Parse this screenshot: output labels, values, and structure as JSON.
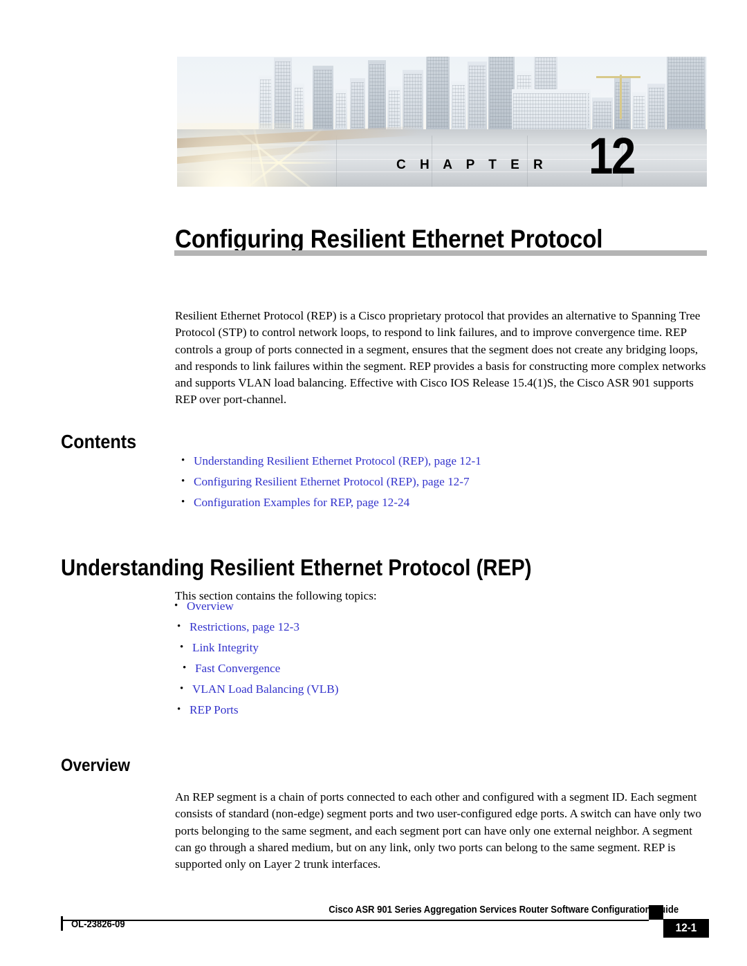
{
  "banner": {
    "chapter_word": "C H A P T E R",
    "chapter_number": "12",
    "image_description": "city-skyline-sunrise-photo"
  },
  "chapter_title": "Configuring Resilient Ethernet Protocol",
  "intro_paragraph": "Resilient Ethernet Protocol (REP) is a Cisco proprietary protocol that provides an alternative to Spanning Tree Protocol (STP) to control network loops, to respond to link failures, and to improve convergence time. REP controls a group of ports connected in a segment, ensures that the segment does not create any bridging loops, and responds to link failures within the segment. REP provides a basis for constructing more complex networks and supports VLAN load balancing. Effective with Cisco IOS Release 15.4(1)S, the Cisco ASR 901 supports REP over port-channel.",
  "contents": {
    "heading": "Contents",
    "items": [
      "Understanding Resilient Ethernet Protocol (REP), page 12-1",
      "Configuring Resilient Ethernet Protocol (REP), page 12-7",
      "Configuration Examples for REP, page 12-24"
    ]
  },
  "understanding": {
    "heading": "Understanding Resilient Ethernet Protocol (REP)",
    "intro": "This section contains the following topics:",
    "topics": [
      "Overview",
      "Restrictions, page 12-3",
      "Link Integrity",
      "Fast Convergence",
      "VLAN Load Balancing (VLB)",
      "REP Ports"
    ]
  },
  "overview": {
    "heading": "Overview",
    "paragraph": "An REP segment is a chain of ports connected to each other and configured with a segment ID. Each segment consists of standard (non-edge) segment ports and two user-configured edge ports. A switch can have only two ports belonging to the same segment, and each segment port can have only one external neighbor. A segment can go through a shared medium, but on any link, only two ports can belong to the same segment. REP is supported only on Layer 2 trunk interfaces."
  },
  "footer": {
    "guide_title": "Cisco ASR 901 Series Aggregation Services Router Software Configuration Guide",
    "doc_id": "OL-23826-09",
    "page_number": "12-1"
  },
  "colors": {
    "link_blue": "#3333CC",
    "title_rule_gray": "#B4B4B4",
    "footer_black": "#000000"
  }
}
